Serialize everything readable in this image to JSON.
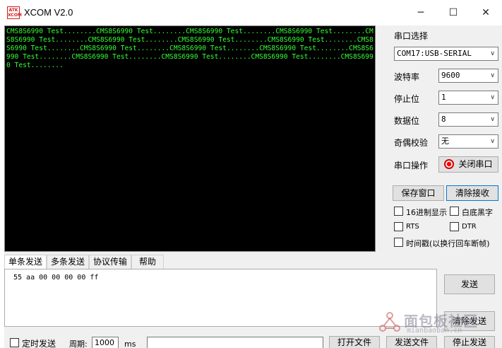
{
  "window": {
    "logo_text": "ATK\nXCOM",
    "title": "XCOM V2.0",
    "minimize_glyph": "─",
    "maximize_glyph": "☐",
    "close_glyph": "✕"
  },
  "terminal": {
    "text": "CMS8S6990 Test........CMS8S6990 Test........CMS8S6990 Test........CMS8S6990 Test........CMS8S6990 Test........CMS8S6990 Test........CMS8S6990 Test........CMS8S6990 Test........CMS8S6990 Test........CMS8S6990 Test........CMS8S6990 Test........CMS8S6990 Test........CMS8S6990 Test........CMS8S6990 Test........CMS8S6990 Test........CMS8S6990 Test........CMS8S6990 Test........",
    "text_color": "#33ff33",
    "background": "#000000"
  },
  "serial": {
    "port_label": "串口选择",
    "port_value": "COM17:USB-SERIAL",
    "baud_label": "波特率",
    "baud_value": "9600",
    "stop_label": "停止位",
    "stop_value": "1",
    "data_label": "数据位",
    "data_value": "8",
    "parity_label": "奇偶校验",
    "parity_value": "无",
    "op_label": "串口操作",
    "op_button": "关闭串口"
  },
  "actions": {
    "save_window": "保存窗口",
    "clear_receive": "清除接收"
  },
  "options": {
    "hex_display": "16进制显示",
    "white_bg": "白底黑字",
    "rts": "RTS",
    "dtr": "DTR",
    "timestamp": "时间戳(以换行回车断帧)"
  },
  "tabs": [
    "单条发送",
    "多条发送",
    "协议传输",
    "帮助"
  ],
  "send": {
    "content": "55 aa 00 00 00 00 ff",
    "send_button": "发送",
    "clear_send_button": "清除发送"
  },
  "bottom": {
    "timed_send": "定时发送",
    "period_label": "周期:",
    "period_value": "1000",
    "period_unit": "ms",
    "open_file": "打开文件",
    "send_file": "发送文件",
    "stop_send": "停止发送"
  },
  "watermark": {
    "text": "面包板社区",
    "sub": "mianbaoban.cn"
  },
  "arrow_glyph": "∨"
}
